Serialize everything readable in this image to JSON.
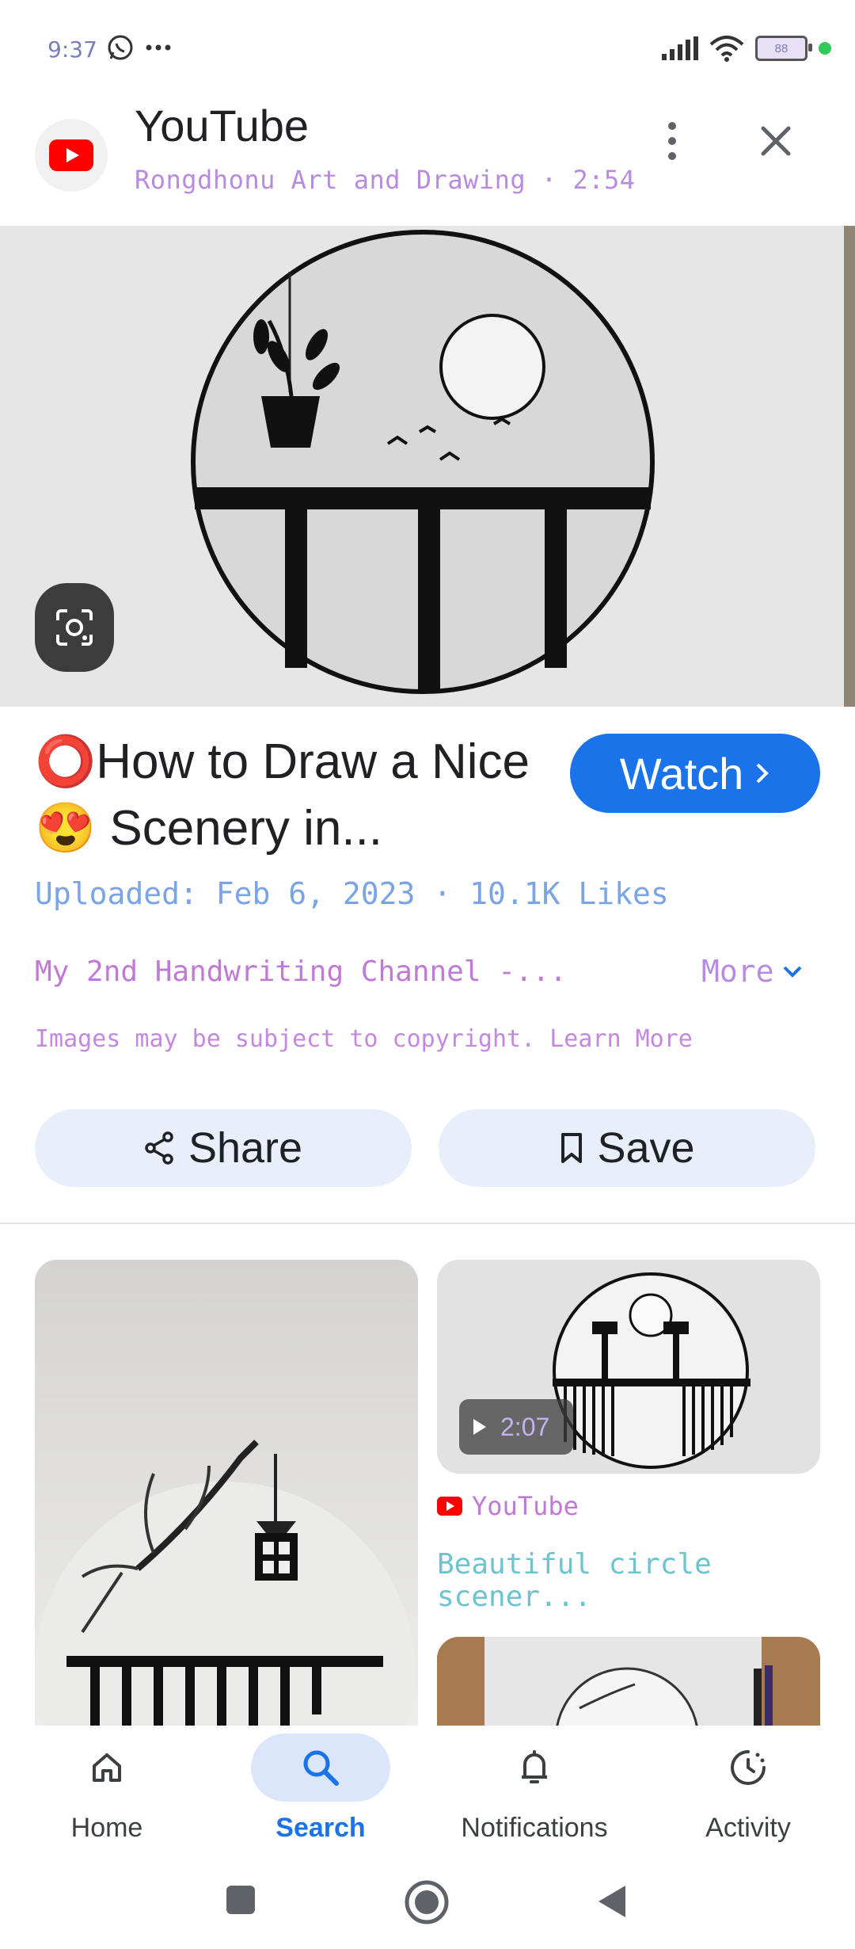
{
  "status_bar": {
    "time": "9:37",
    "battery": "88",
    "icons": [
      "whatsapp-icon",
      "more-dots-icon",
      "signal-icon",
      "wifi-icon",
      "battery-icon"
    ]
  },
  "header": {
    "app_name": "YouTube",
    "subtitle": "Rongdhonu Art and Drawing · 2:54"
  },
  "result": {
    "title": "⭕How to Draw a Nice😍 Scenery in...",
    "watch_label": "Watch",
    "upload_info": "Uploaded: Feb 6, 2023 · 10.1K Likes",
    "channel_desc": "My 2nd Handwriting Channel -...",
    "more_label": "More",
    "copyright": "Images may be subject to copyright. Learn More",
    "share_label": "Share",
    "save_label": "Save"
  },
  "related": {
    "right_card": {
      "duration": "2:07",
      "source": "YouTube",
      "title": "Beautiful circle scener..."
    }
  },
  "bottom_nav": {
    "items": [
      {
        "label": "Home",
        "icon": "home-icon"
      },
      {
        "label": "Search",
        "icon": "search-icon",
        "active": true
      },
      {
        "label": "Notifications",
        "icon": "bell-icon"
      },
      {
        "label": "Activity",
        "icon": "activity-icon"
      }
    ]
  },
  "colors": {
    "accent": "#1a73e8",
    "active_pill": "#dbe6fb",
    "button_bg": "#e8effb"
  }
}
